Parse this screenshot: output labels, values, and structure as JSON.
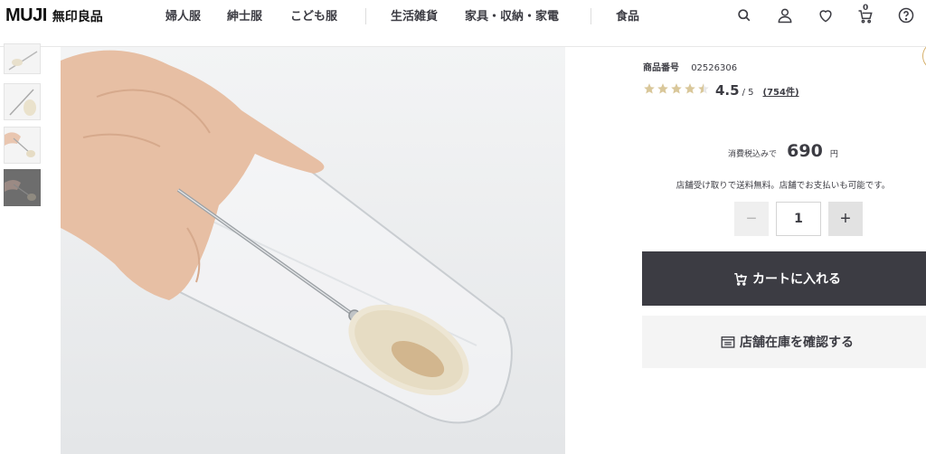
{
  "header": {
    "logo_main": "MUJI",
    "logo_jp": "無印良品",
    "nav": [
      "婦人服",
      "紳士服",
      "こども服",
      "生活雑貨",
      "家具・収納・家電",
      "食品"
    ],
    "cart_count": "0",
    "icons": [
      "search-icon",
      "user-icon",
      "heart-icon",
      "cart-icon",
      "help-icon"
    ]
  },
  "gallery": {
    "thumbnails": 4,
    "active_index": 3
  },
  "product": {
    "sku_label": "商品番号",
    "sku": "02526306",
    "rating_value": "4.5",
    "rating_max": "/ 5",
    "rating_count": "(754件)",
    "rating_fraction": 0.9,
    "price_label": "消費税込みで",
    "price": "690",
    "price_unit": "円",
    "pickup_note": "店舗受け取りで送料無料。店舗でお支払いも可能です。",
    "quantity": "1",
    "qty_minus": "−",
    "qty_plus": "+",
    "add_to_cart": "カートに入れる",
    "check_store": "店舗在庫を確認する"
  },
  "colors": {
    "text": "#3c3c43",
    "star": "#d9c79a",
    "button_dark": "#3c3c43",
    "button_light": "#f4f4f4"
  }
}
